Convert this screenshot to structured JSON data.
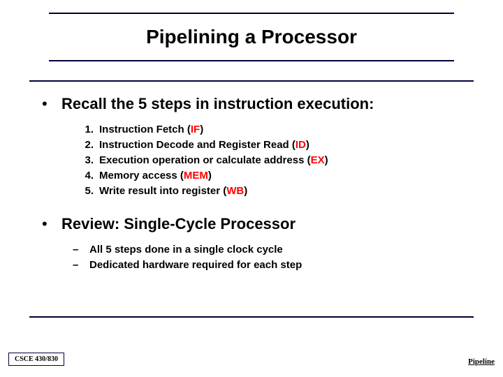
{
  "title": "Pipelining a Processor",
  "bullets": [
    {
      "text": "Recall the 5 steps in instruction execution:",
      "numbered": [
        {
          "n": "1.",
          "pre": "Instruction Fetch (",
          "abbr": "IF",
          "post": ")"
        },
        {
          "n": "2.",
          "pre": "Instruction Decode and Register Read (",
          "abbr": "ID",
          "post": ")"
        },
        {
          "n": "3.",
          "pre": "Execution operation or calculate address (",
          "abbr": "EX",
          "post": ")"
        },
        {
          "n": "4.",
          "pre": "Memory access (",
          "abbr": "MEM",
          "post": ")"
        },
        {
          "n": "5.",
          "pre": "Write result into register (",
          "abbr": "WB",
          "post": ")"
        }
      ]
    },
    {
      "text": "Review: Single-Cycle Processor",
      "dashed": [
        "All 5 steps done in a single clock cycle",
        "Dedicated hardware required for each step"
      ]
    }
  ],
  "footer": {
    "left": "CSCE 430/830",
    "right": "Pipeline"
  }
}
